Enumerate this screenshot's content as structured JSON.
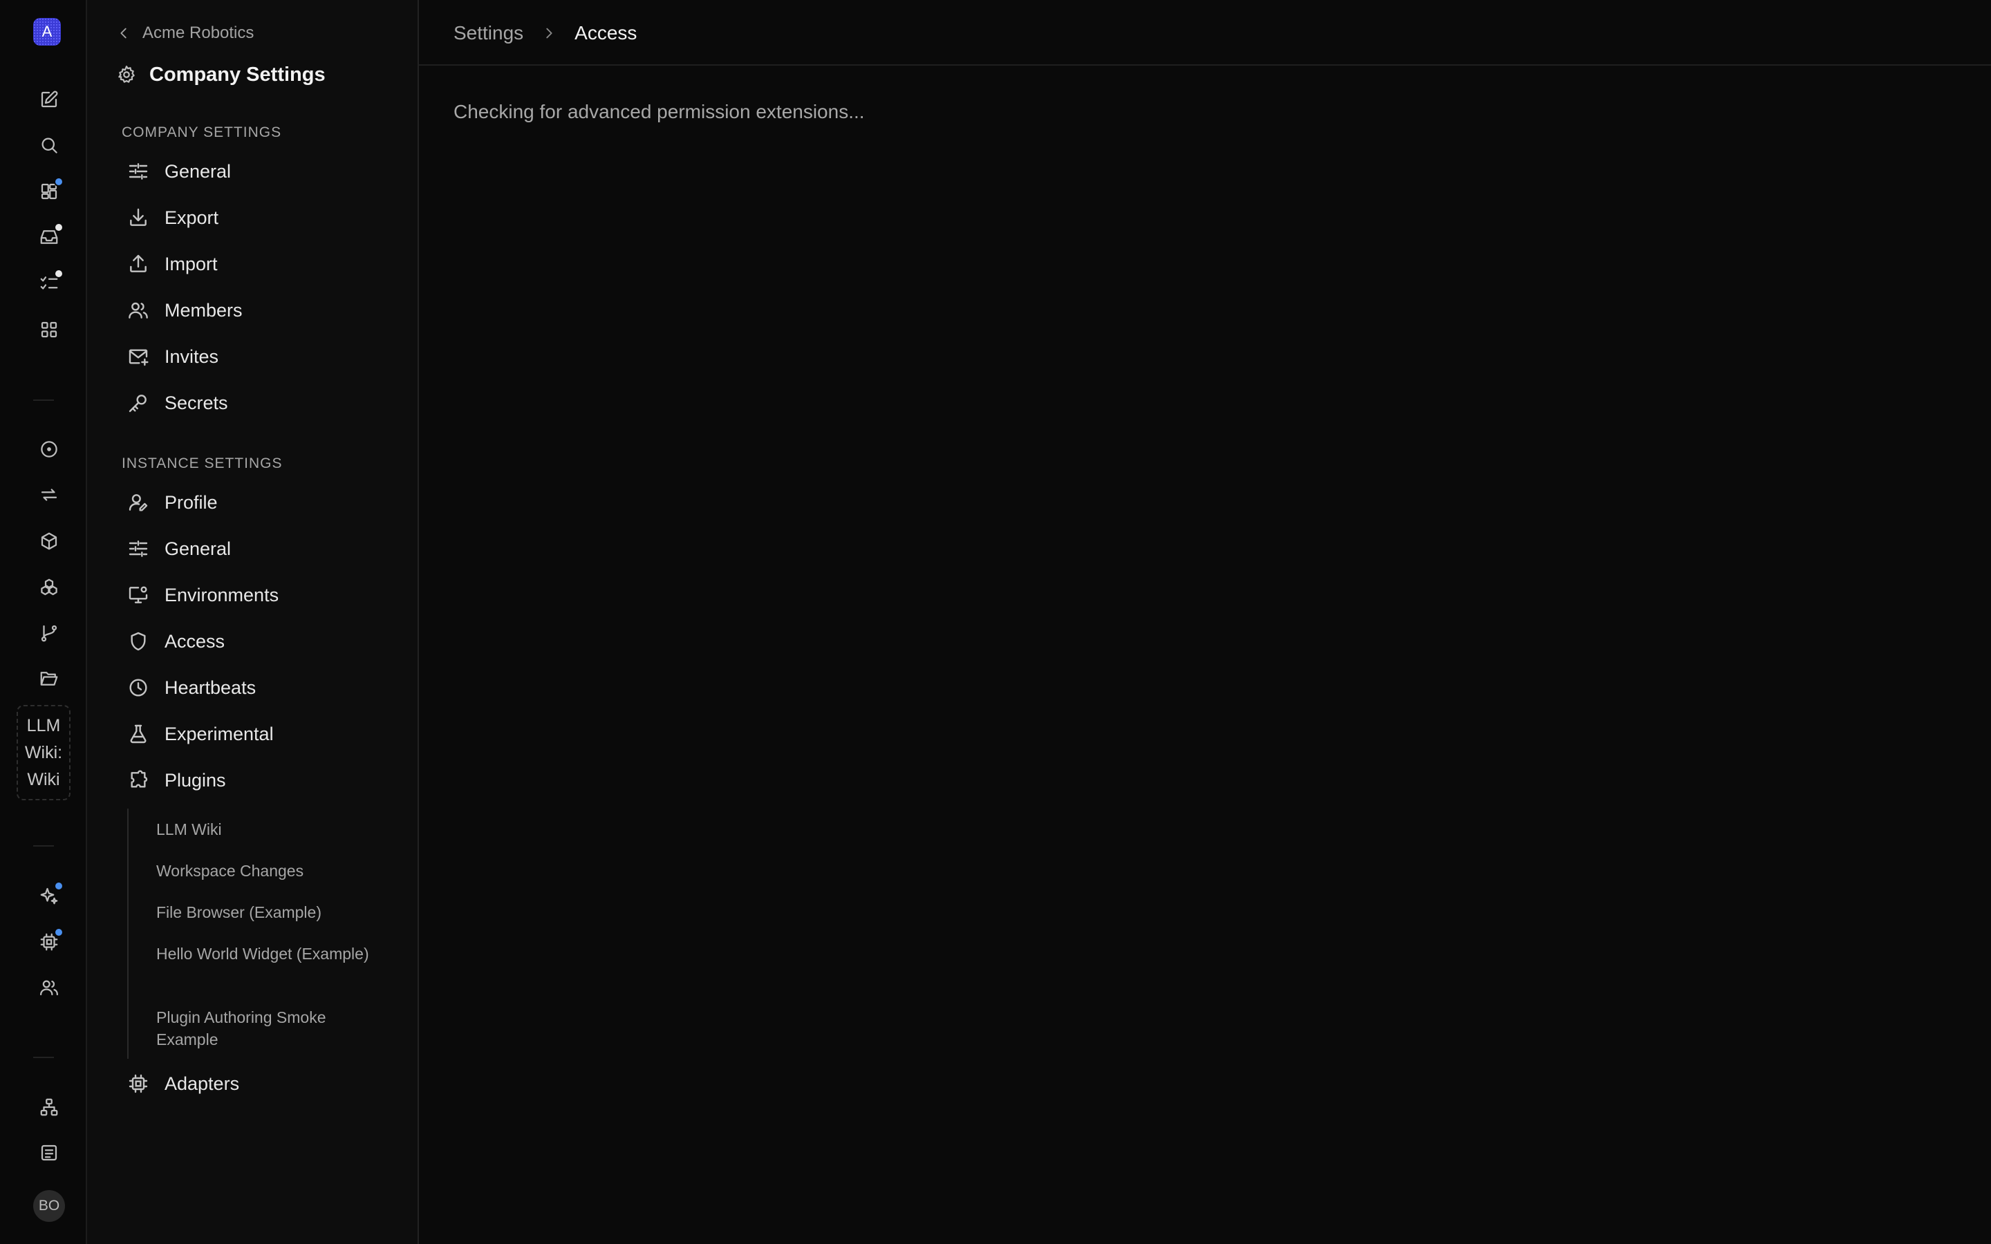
{
  "rail": {
    "company_initial": "A",
    "plugin_tile_lines": [
      "LLM",
      "Wiki:",
      "Wiki"
    ],
    "avatar_initials": "BO",
    "badge_colors": {
      "blue": "#4a90f0",
      "white": "#e8e8e8"
    }
  },
  "sidebar": {
    "back_label": "Acme Robotics",
    "title": "Company Settings",
    "company_section_label": "COMPANY SETTINGS",
    "company_items": [
      {
        "label": "General",
        "icon": "sliders-icon"
      },
      {
        "label": "Export",
        "icon": "download-icon"
      },
      {
        "label": "Import",
        "icon": "upload-icon"
      },
      {
        "label": "Members",
        "icon": "users-icon"
      },
      {
        "label": "Invites",
        "icon": "mail-plus-icon"
      },
      {
        "label": "Secrets",
        "icon": "key-icon"
      }
    ],
    "instance_section_label": "INSTANCE SETTINGS",
    "instance_items": [
      {
        "label": "Profile",
        "icon": "user-pen-icon"
      },
      {
        "label": "General",
        "icon": "sliders-icon"
      },
      {
        "label": "Environments",
        "icon": "monitor-cog-icon"
      },
      {
        "label": "Access",
        "icon": "shield-icon"
      },
      {
        "label": "Heartbeats",
        "icon": "clock-icon"
      },
      {
        "label": "Experimental",
        "icon": "flask-icon"
      },
      {
        "label": "Plugins",
        "icon": "puzzle-icon"
      }
    ],
    "plugin_subitems": [
      "LLM Wiki",
      "Workspace Changes",
      "File Browser (Example)",
      "Hello World Widget (Example)",
      "Plugin Authoring Smoke Example"
    ],
    "adapters_label": "Adapters"
  },
  "main": {
    "breadcrumb_root": "Settings",
    "breadcrumb_current": "Access",
    "status_message": "Checking for advanced permission extensions..."
  }
}
